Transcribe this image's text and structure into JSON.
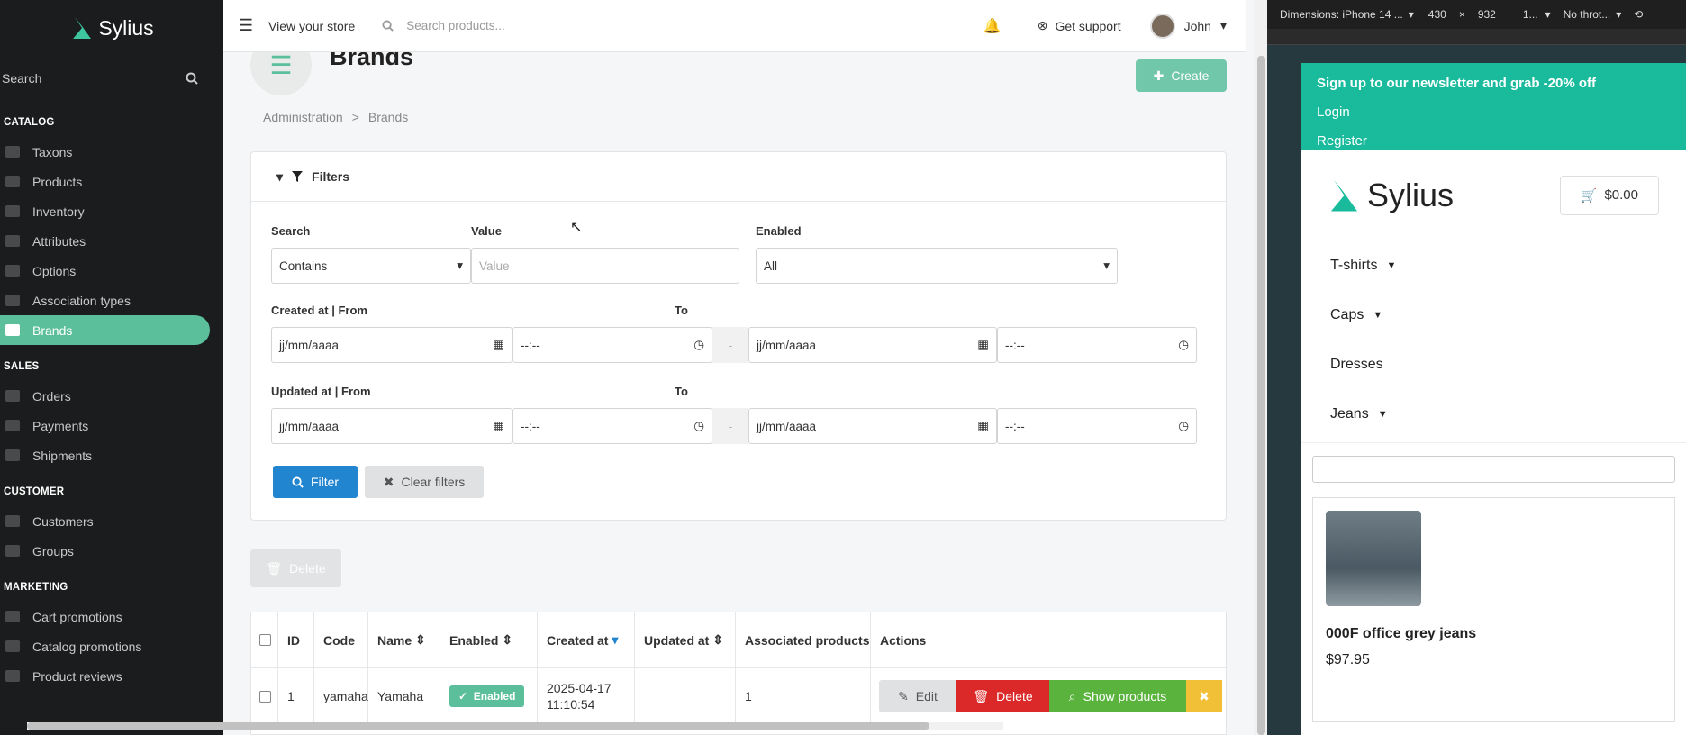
{
  "sidebar": {
    "brand": "Sylius",
    "search_label": "Search",
    "sections": [
      {
        "title": "CATALOG",
        "items": [
          "Taxons",
          "Products",
          "Inventory",
          "Attributes",
          "Options",
          "Association types",
          "Brands"
        ]
      },
      {
        "title": "SALES",
        "items": [
          "Orders",
          "Payments",
          "Shipments"
        ]
      },
      {
        "title": "CUSTOMER",
        "items": [
          "Customers",
          "Groups"
        ]
      },
      {
        "title": "MARKETING",
        "items": [
          "Cart promotions",
          "Catalog promotions",
          "Product reviews"
        ]
      }
    ],
    "active_item": "Brands"
  },
  "topbar": {
    "view_store": "View your store",
    "search_placeholder": "Search products...",
    "support": "Get support",
    "user": "John"
  },
  "page": {
    "title": "Brands",
    "create_label": "Create",
    "breadcrumb": [
      "Administration",
      "Brands"
    ],
    "breadcrumb_sep": ">"
  },
  "filters": {
    "title": "Filters",
    "search_label": "Search",
    "search_type": "Contains",
    "value_label": "Value",
    "value_placeholder": "Value",
    "enabled_label": "Enabled",
    "enabled_value": "All",
    "created_from_label": "Created at | From",
    "updated_from_label": "Updated at | From",
    "to_label": "To",
    "date_placeholder": "jj/mm/aaaa",
    "time_placeholder": "--:--",
    "dash": "-",
    "filter_btn": "Filter",
    "clear_btn": "Clear filters"
  },
  "bulk_delete": "Delete",
  "table": {
    "headers": [
      "ID",
      "Code",
      "Name",
      "Enabled",
      "Created at",
      "Updated at",
      "Associated products",
      "Actions"
    ],
    "rows": [
      {
        "id": "1",
        "code": "yamaha",
        "name": "Yamaha",
        "enabled": "Enabled",
        "created": "2025-04-17 11:10:54",
        "updated": "",
        "associated": "1"
      }
    ],
    "actions": [
      "Edit",
      "Delete",
      "Show products"
    ]
  },
  "devtools": {
    "dimensions": "Dimensions: iPhone 14 ...",
    "width": "430",
    "times": "×",
    "height": "932",
    "zoom": "1...",
    "throttle": "No throt..."
  },
  "shop": {
    "promo": "Sign up to our newsletter and grab -20% off",
    "login": "Login",
    "register": "Register",
    "brand": "Sylius",
    "cart": "$0.00",
    "nav": [
      "T-shirts",
      "Caps",
      "Dresses",
      "Jeans"
    ],
    "product_name": "000F office grey jeans",
    "product_price": "$97.95"
  },
  "colors": {
    "accent": "#5bbf9c",
    "primary": "#2185d0",
    "danger": "#db2828",
    "success": "#5ab33d",
    "warning": "#f2c037"
  }
}
